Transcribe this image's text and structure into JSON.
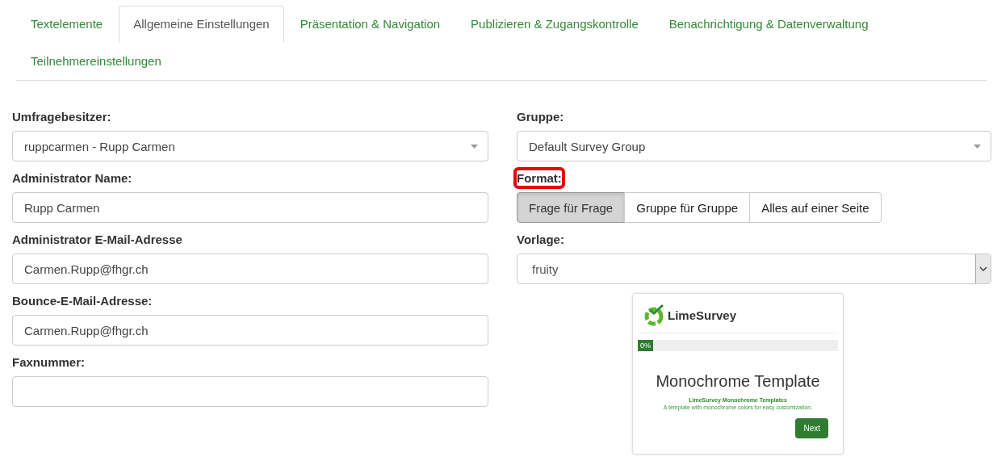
{
  "tabs": [
    {
      "label": "Textelemente",
      "selected": false
    },
    {
      "label": "Allgemeine Einstellungen",
      "selected": true
    },
    {
      "label": "Präsentation & Navigation",
      "selected": false
    },
    {
      "label": "Publizieren & Zugangskontrolle",
      "selected": false
    },
    {
      "label": "Benachrichtigung & Datenverwaltung",
      "selected": false
    },
    {
      "label": "Teilnehmereinstellungen",
      "selected": false
    }
  ],
  "left_column": [
    {
      "kind": "select",
      "label": "Umfragebesitzer:",
      "value": "ruppcarmen - Rupp Carmen"
    },
    {
      "kind": "text",
      "label": "Administrator Name:",
      "value": "Rupp Carmen"
    },
    {
      "kind": "text",
      "label": "Administrator E-Mail-Adresse",
      "value": "Carmen.Rupp@fhgr.ch"
    },
    {
      "kind": "text",
      "label": "Bounce-E-Mail-Adresse:",
      "value": "Carmen.Rupp@fhgr.ch"
    },
    {
      "kind": "text",
      "label": "Faxnummer:"
    }
  ],
  "right_column": [
    {
      "kind": "select",
      "label": "Gruppe:",
      "value": "Default Survey Group"
    },
    {
      "kind": "segmented",
      "label": "Format:",
      "highlighted": true,
      "options": [
        {
          "label": "Frage für Frage",
          "selected": true
        },
        {
          "label": "Gruppe für Gruppe",
          "selected": false
        },
        {
          "label": "Alles auf einer Seite",
          "selected": false
        }
      ]
    },
    {
      "kind": "native-select",
      "label": "Vorlage:",
      "value": "fruity"
    }
  ],
  "template_preview": {
    "logo_text": "LimeSurvey",
    "progress": "0%",
    "level": 0,
    "heading": "Monochrome Template",
    "subtitle": "LimeSurvey Monochrome Templates",
    "description": "A template with monochrome colors for easy customization.",
    "button": "Next"
  }
}
